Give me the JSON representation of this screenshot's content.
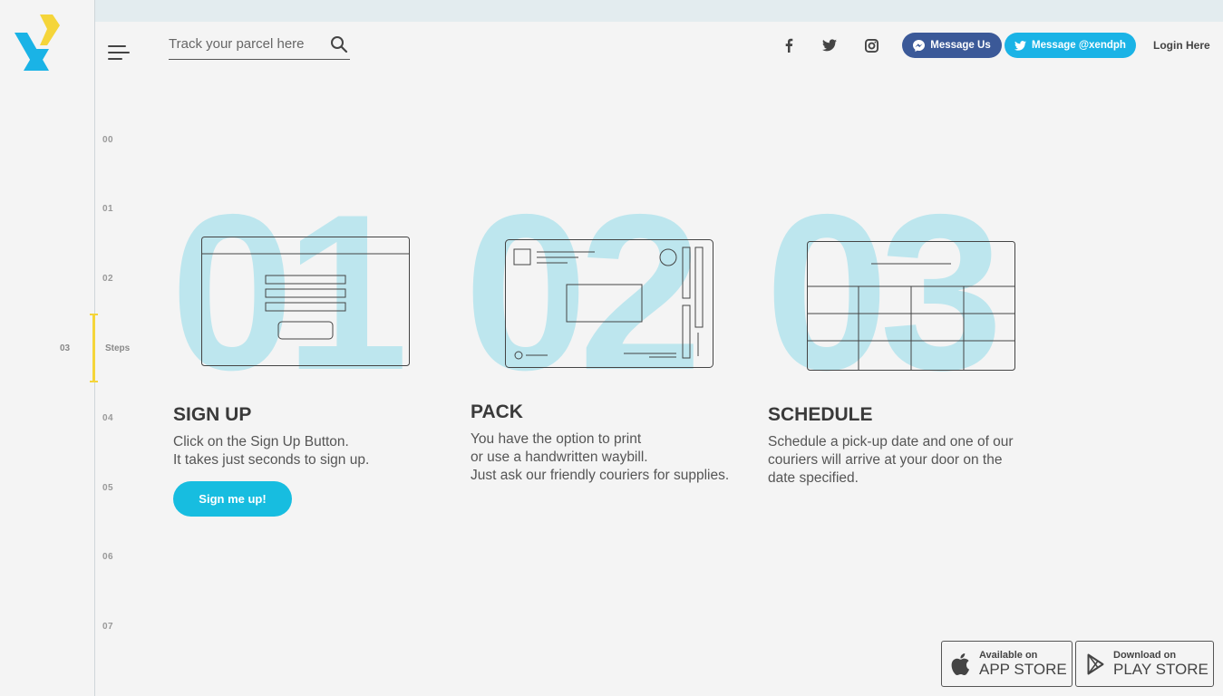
{
  "header": {
    "search_placeholder": "Track your parcel here",
    "message_us": "Message Us",
    "message_twitter": "Message @xendph",
    "login": "Login Here"
  },
  "steps_nav": {
    "items": [
      "00",
      "01",
      "02",
      "04",
      "05",
      "06",
      "07"
    ],
    "active_number": "03",
    "active_label": "Steps"
  },
  "steps": [
    {
      "number": "01",
      "title": "SIGN UP",
      "lines": [
        "Click on the Sign Up Button.",
        "It takes just seconds to sign up."
      ]
    },
    {
      "number": "02",
      "title": "PACK",
      "lines": [
        "You have the option to print",
        "or use a handwritten waybill.",
        "Just ask our friendly couriers for supplies."
      ]
    },
    {
      "number": "03",
      "title": "SCHEDULE",
      "lines": [
        "Schedule a pick-up date and one of our",
        "couriers will arrive at your door on the",
        "date specified."
      ]
    }
  ],
  "signup_button": "Sign me up!",
  "stores": {
    "app_store": {
      "line1": "Available on",
      "line2": "APP STORE"
    },
    "play_store": {
      "line1": "Download on",
      "line2": "PLAY STORE"
    }
  },
  "colors": {
    "accent": "#17bde0",
    "messenger": "#3b5998",
    "twitter": "#1ab3e6",
    "highlight": "#f5d53a",
    "big_number": "#bde6ee"
  },
  "icons": [
    "logo-icon",
    "menu-icon",
    "search-icon",
    "facebook-icon",
    "twitter-icon",
    "instagram-icon",
    "messenger-icon",
    "apple-icon",
    "play-icon"
  ]
}
